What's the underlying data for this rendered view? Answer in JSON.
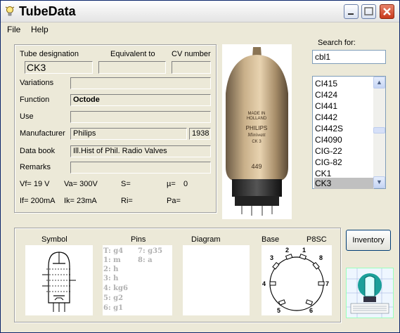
{
  "window": {
    "title": "TubeData"
  },
  "menu": {
    "file": "File",
    "help": "Help"
  },
  "headers": {
    "tube_designation": "Tube designation",
    "equivalent_to": "Equivalent to",
    "cv_number": "CV number"
  },
  "fields": {
    "tube_designation": "CK3",
    "equivalent_to": "",
    "cv_number": "",
    "variations": "",
    "function": "Octode",
    "use": "",
    "manufacturer": "Philips",
    "year": "1938",
    "data_book": "Ill.Hist of Phil. Radio Valves",
    "remarks": ""
  },
  "labels": {
    "variations": "Variations",
    "function": "Function",
    "use": "Use",
    "manufacturer": "Manufacturer",
    "data_book": "Data book",
    "remarks": "Remarks"
  },
  "params": {
    "vf": "Vf= 19 V",
    "va": "Va= 300V",
    "s": "S=",
    "mu": "µ=",
    "mu_value": "0",
    "if": "If= 200mA",
    "ik": "Ik= 23mA",
    "ri": "Ri=",
    "pa": "Pa="
  },
  "search": {
    "label": "Search for:",
    "value": "cbl1"
  },
  "tube_list": {
    "items": [
      "CI415",
      "CI424",
      "CI441",
      "CI442",
      "CI442S",
      "CI4090",
      "CIG-22",
      "CIG-82",
      "CK1",
      "CK3"
    ],
    "selected": "CK3"
  },
  "photo": {
    "print_lines": [
      "MADE IN",
      "HOLLAND",
      "PHILIPS",
      "Miniwatt",
      "CK 3",
      "449"
    ]
  },
  "bottom_headers": {
    "symbol": "Symbol",
    "pins": "Pins",
    "diagram": "Diagram",
    "base": "Base",
    "base_type": "P8SC"
  },
  "pins": {
    "col1": [
      "T: g4",
      "1: m",
      "2: h",
      "3: h",
      "4: kg6",
      "5: g2",
      "6: g1"
    ],
    "col2": [
      "7: g35",
      "8: a"
    ]
  },
  "base_pin_numbers": [
    "1",
    "2",
    "3",
    "4",
    "5",
    "6",
    "7",
    "8"
  ],
  "inventory_button": "Inventory",
  "colors": {
    "title_bar": "#f3f3f3",
    "selected_item": "#c0c0c0",
    "window_bg": "#ece9d8",
    "close_button": "#c8391c"
  },
  "icons": [
    "lightbulb-icon",
    "minimize-icon",
    "maximize-icon",
    "close-icon",
    "scroll-up-icon",
    "scroll-down-icon"
  ]
}
